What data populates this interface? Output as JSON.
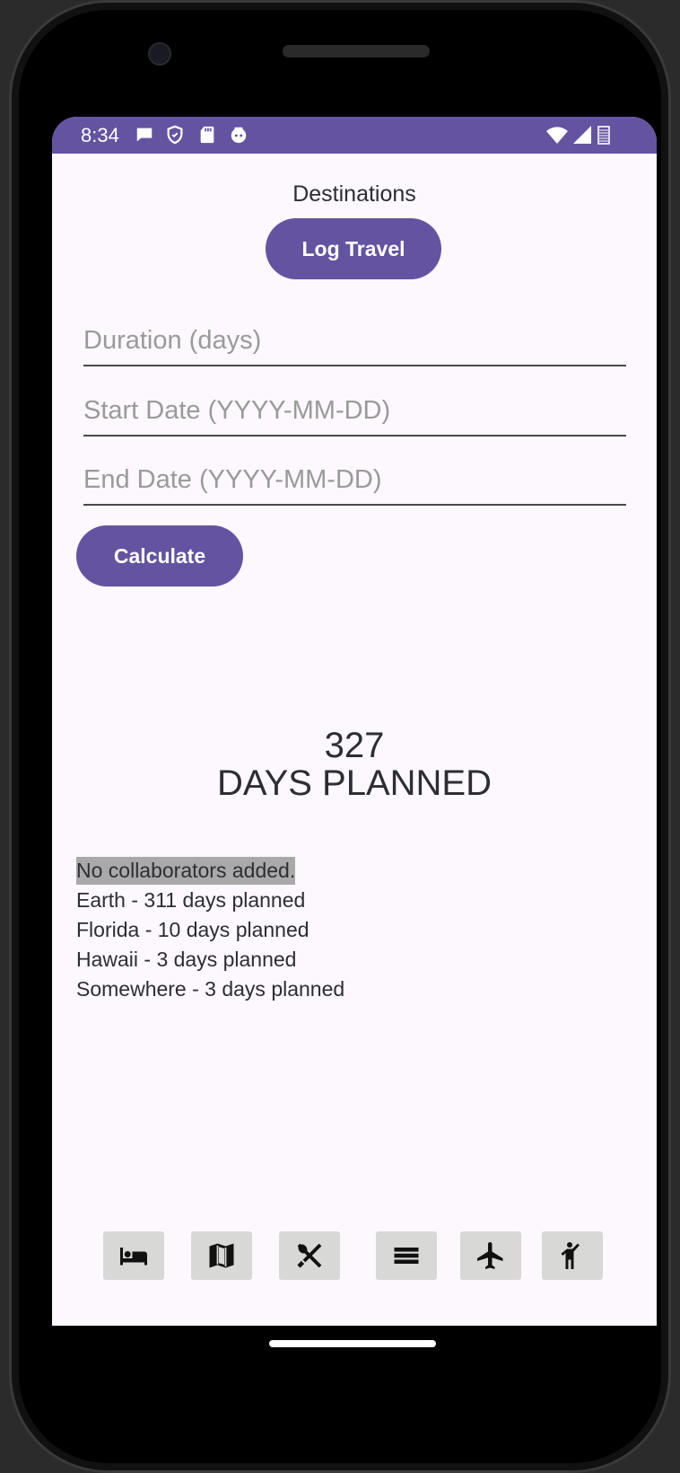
{
  "status_bar": {
    "time": "8:34",
    "left_icons": [
      "chat-bubble-icon",
      "shield-icon",
      "sd-card-icon",
      "robot-face-icon"
    ],
    "right_icons": [
      "wifi-icon",
      "signal-icon",
      "battery-icon"
    ],
    "background_color": "#6453a0"
  },
  "header": {
    "title": "Destinations",
    "log_travel_label": "Log Travel"
  },
  "form": {
    "duration_placeholder": "Duration (days)",
    "start_date_placeholder": "Start Date (YYYY-MM-DD)",
    "end_date_placeholder": "End Date (YYYY-MM-DD)",
    "calculate_label": "Calculate"
  },
  "summary": {
    "total_days": "327",
    "total_label": "DAYS PLANNED"
  },
  "collaborators_text": "No collaborators added.",
  "destinations": [
    "Earth - 311 days planned",
    "Florida - 10 days planned",
    "Hawaii - 3 days planned",
    "Somewhere - 3 days planned"
  ],
  "bottom_nav": [
    {
      "icon": "bed-icon"
    },
    {
      "icon": "map-icon"
    },
    {
      "icon": "restaurant-icon"
    },
    {
      "icon": "menu-lines-icon"
    },
    {
      "icon": "airplane-icon"
    },
    {
      "icon": "person-hiking-icon"
    }
  ],
  "colors": {
    "accent": "#6453a0",
    "screen_background": "#fcf8fd",
    "nav_button": "#d8d9d6",
    "highlight": "#a9a9a9"
  }
}
